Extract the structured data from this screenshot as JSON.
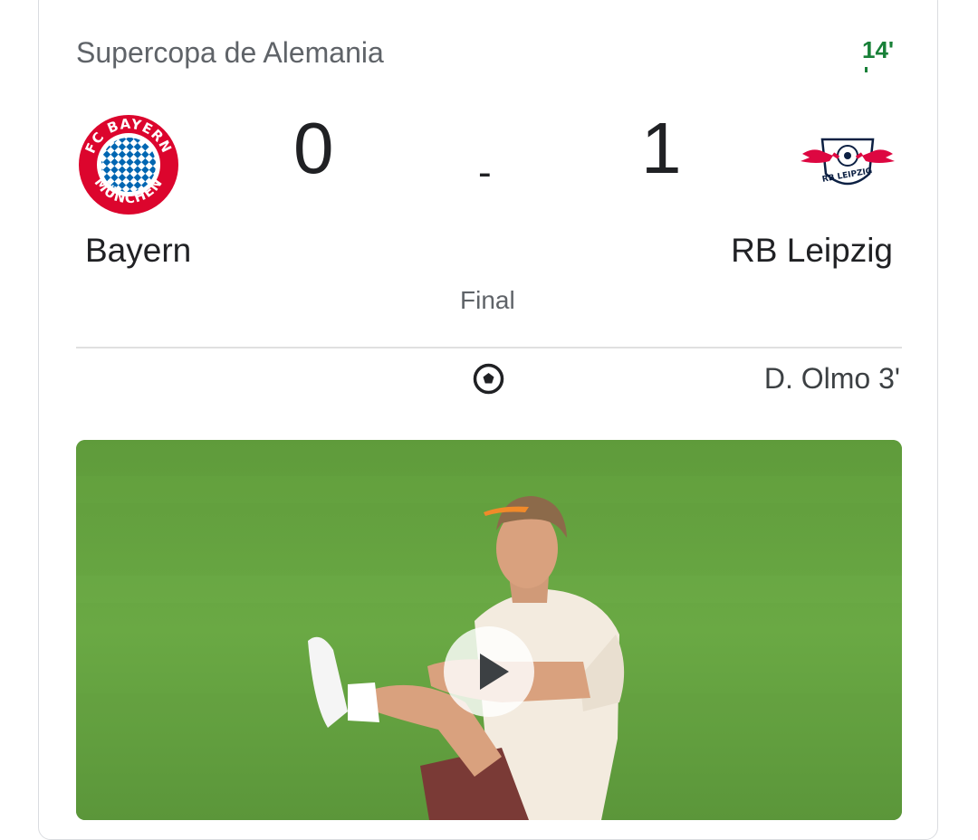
{
  "match": {
    "competition": "Supercopa de Alemania",
    "minute": "14'",
    "status": "Final",
    "separator": "-",
    "home": {
      "name": "Bayern",
      "score": "0",
      "logo_icon": "fc-bayern-crest"
    },
    "away": {
      "name": "RB Leipzig",
      "score": "1",
      "logo_icon": "rb-leipzig-crest"
    }
  },
  "events": [
    {
      "icon": "soccer-ball-icon",
      "team": "away",
      "text": "D. Olmo 3'"
    }
  ],
  "video": {
    "play_icon": "play-icon"
  },
  "colors": {
    "minute": "#188038",
    "bayern_red": "#dc052d",
    "bayern_blue": "#0066b2",
    "leipzig_red": "#dd0741",
    "pitch": "#6aa843"
  }
}
